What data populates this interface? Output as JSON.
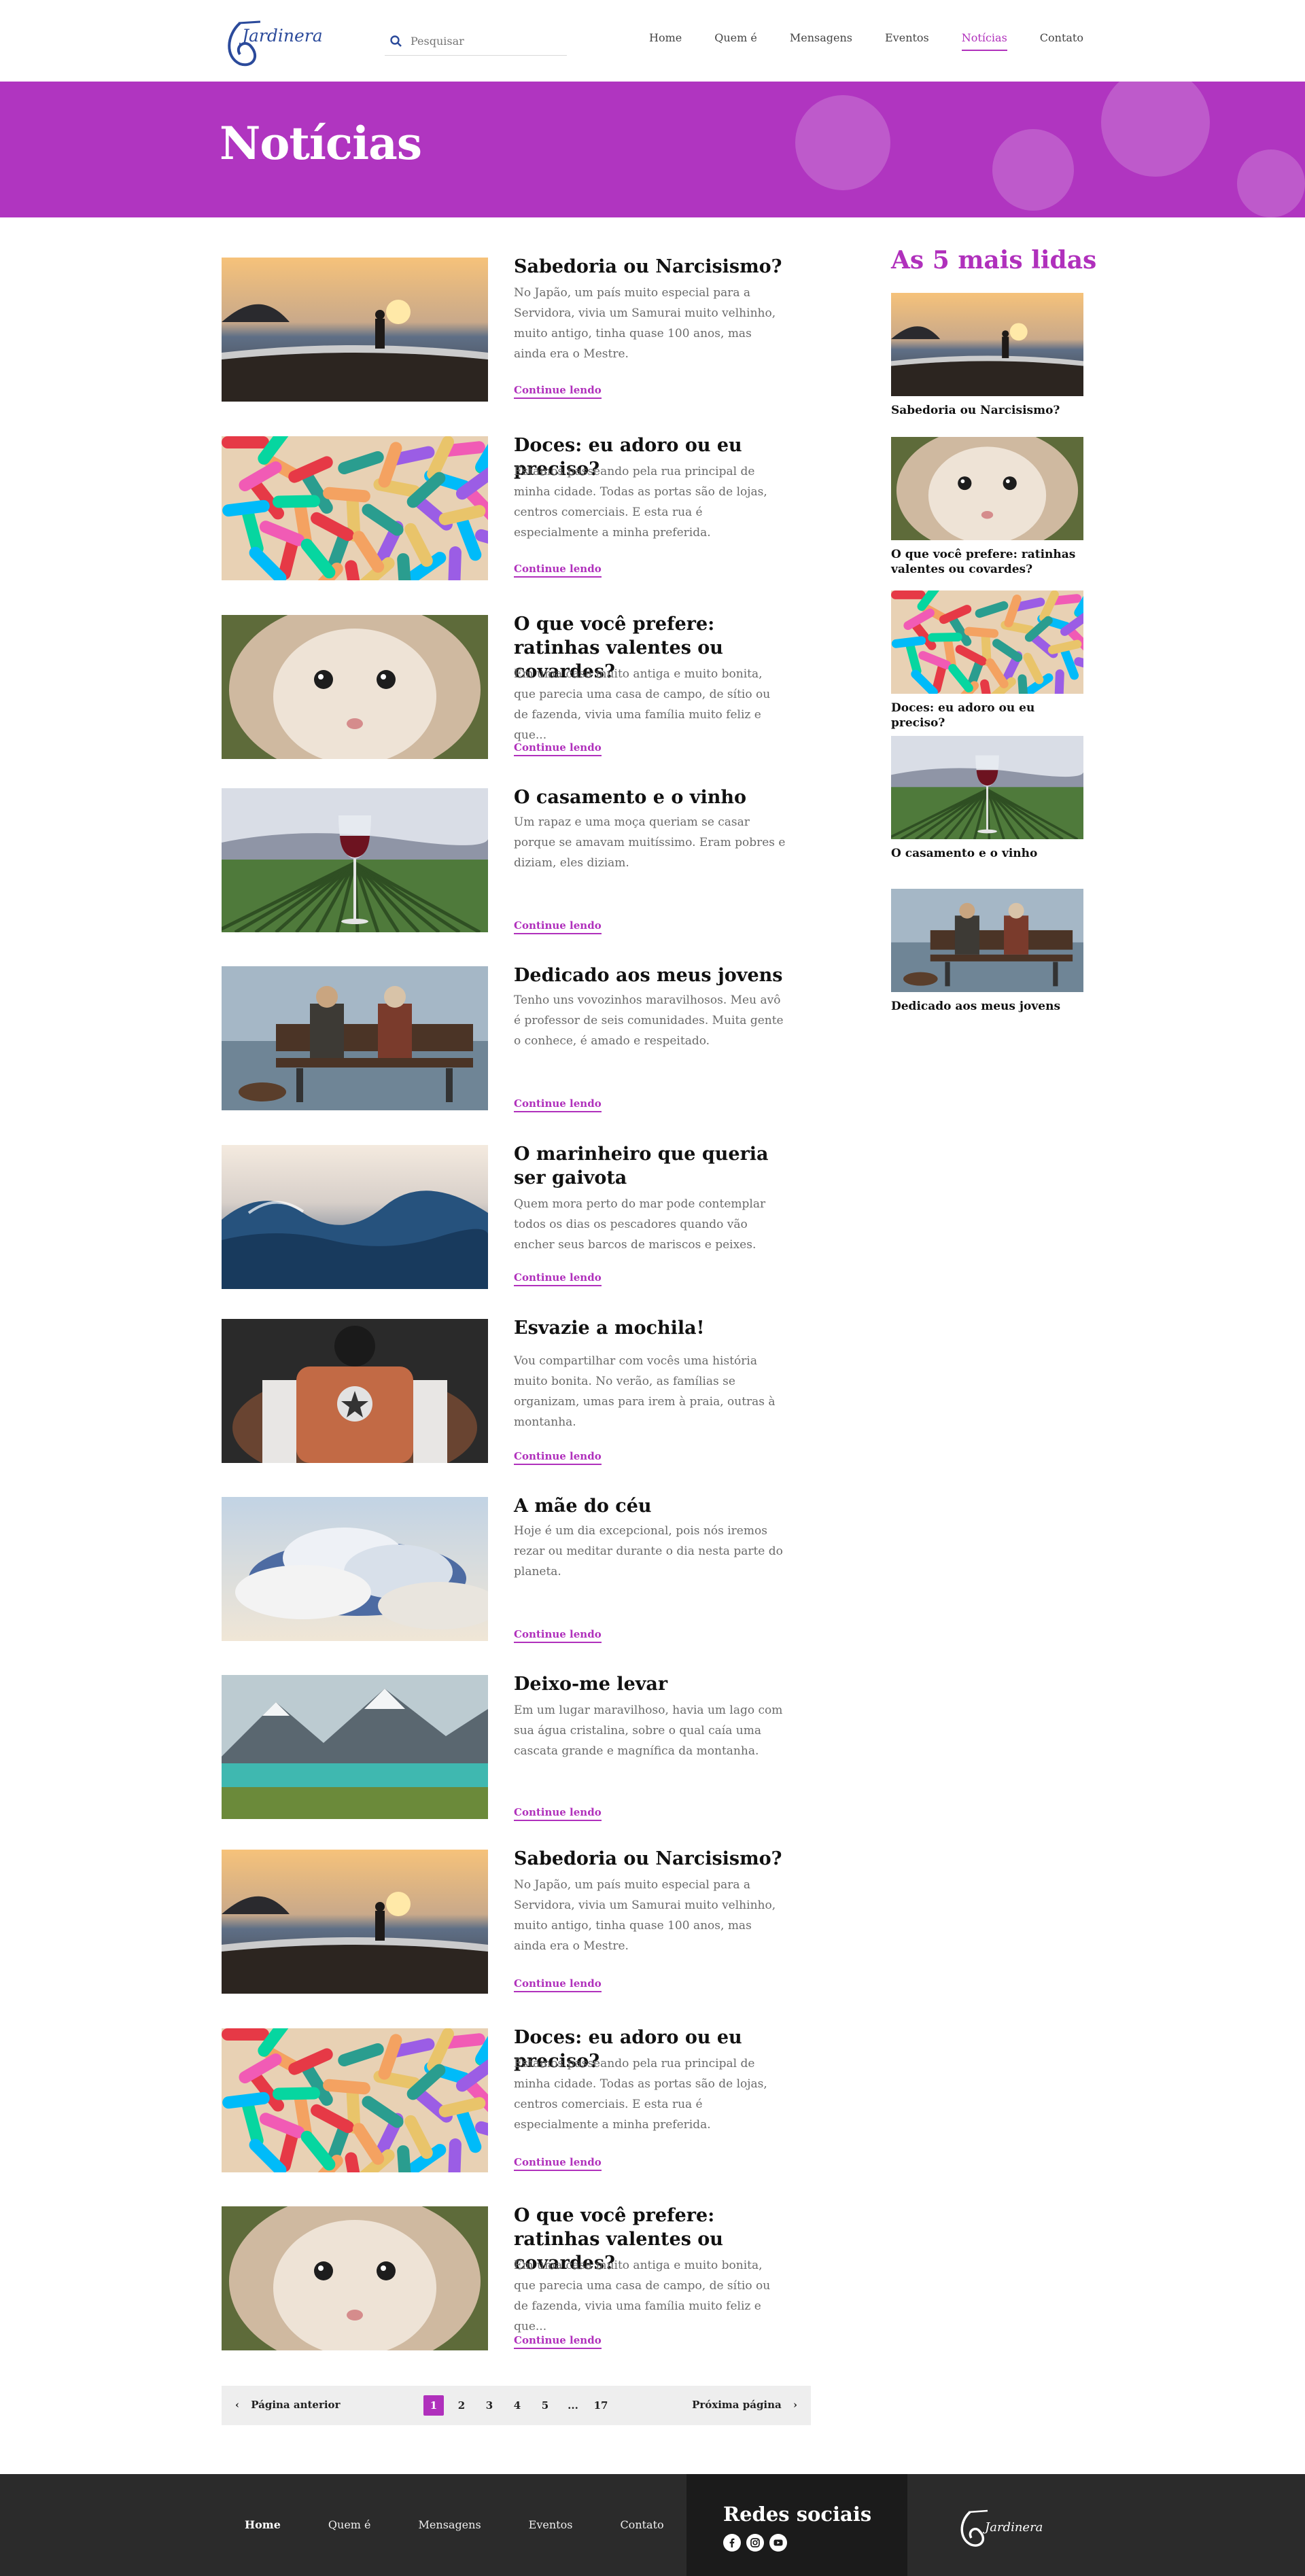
{
  "header": {
    "logo_text": "Jardinera",
    "search_placeholder": "Pesquisar",
    "nav": [
      "Home",
      "Quem é",
      "Mensagens",
      "Eventos",
      "Notícias",
      "Contato"
    ],
    "active_nav": "Notícias"
  },
  "hero": {
    "title": "Notícias"
  },
  "articles": [
    {
      "title": "Sabedoria ou Narcisismo?",
      "excerpt": "No Japão, um país muito especial para a Servidora, vivia um Samurai muito velhinho, muito antigo, tinha quase 100 anos, mas ainda era o Mestre.",
      "image": "beach-walker",
      "read_more": "Continue lendo"
    },
    {
      "title": "Doces: eu adoro ou eu preciso?",
      "excerpt": "Estamos passeando pela rua principal de minha cidade. Todas as portas são de lojas, centros comerciais. E esta rua é especialmente a minha preferida.",
      "image": "gummy-candies",
      "read_more": "Continue lendo"
    },
    {
      "title": "O que você prefere: ratinhas valentes ou covardes?",
      "excerpt": "Em uma casa muito antiga e muito bonita, que parecia uma casa de campo, de sítio ou de fazenda, vivia uma família muito feliz e que...",
      "image": "hamster",
      "read_more": "Continue lendo"
    },
    {
      "title": "O casamento e o vinho",
      "excerpt": "Um rapaz e uma moça queriam se casar porque se amavam muitíssimo. Eram pobres e diziam, eles diziam.",
      "image": "wine-vineyard",
      "read_more": "Continue lendo"
    },
    {
      "title": "Dedicado aos meus jovens",
      "excerpt": "Tenho uns vovozinhos maravilhosos. Meu avô é professor de seis comunidades. Muita gente o conhece, é amado e respeitado.",
      "image": "bench-couple",
      "read_more": "Continue lendo"
    },
    {
      "title": "O marinheiro que queria ser gaivota",
      "excerpt": "Quem mora perto do mar pode contemplar todos os dias os pescadores quando vão encher seus barcos de mariscos e peixes.",
      "image": "ocean-waves",
      "read_more": "Continue lendo"
    },
    {
      "title": "Esvazie a mochila!",
      "excerpt": "Vou compartilhar com vocês uma história muito bonita. No verão, as famílias se organizam, umas para irem à praia, outras à montanha.",
      "image": "backpack",
      "read_more": "Continue lendo"
    },
    {
      "title": "A mãe do céu",
      "excerpt": "Hoje é um dia excepcional, pois nós iremos rezar ou meditar durante o dia nesta parte do planeta.",
      "image": "clouds",
      "read_more": "Continue lendo"
    },
    {
      "title": "Deixo-me levar",
      "excerpt": "Em um lugar maravilhoso, havia um lago com sua água cristalina, sobre o qual caía uma cascata grande e magnífica da montanha.",
      "image": "mountain-lake",
      "read_more": "Continue lendo"
    },
    {
      "title": "Sabedoria ou Narcisismo?",
      "excerpt": "No Japão, um país muito especial para a Servidora, vivia um Samurai muito velhinho, muito antigo, tinha quase 100 anos, mas ainda era o Mestre.",
      "image": "beach-walker",
      "read_more": "Continue lendo"
    },
    {
      "title": "Doces: eu adoro ou eu preciso?",
      "excerpt": "Estamos passeando pela rua principal de minha cidade. Todas as portas são de lojas, centros comerciais. E esta rua é especialmente a minha preferida.",
      "image": "gummy-candies",
      "read_more": "Continue lendo"
    },
    {
      "title": "O que você prefere: ratinhas valentes ou covardes?",
      "excerpt": "Em uma casa muito antiga e muito bonita, que parecia uma casa de campo, de sítio ou de fazenda, vivia uma família muito feliz e que...",
      "image": "hamster",
      "read_more": "Continue lendo"
    }
  ],
  "sidebar": {
    "title": "As 5 mais lidas",
    "items": [
      {
        "label": "Sabedoria ou Narcisismo?",
        "image": "beach-walker"
      },
      {
        "label": "O que você prefere: ratinhas valentes ou covardes?",
        "image": "hamster"
      },
      {
        "label": "Doces: eu adoro ou eu preciso?",
        "image": "gummy-candies"
      },
      {
        "label": "O casamento e o vinho",
        "image": "wine-vineyard"
      },
      {
        "label": "Dedicado aos meus jovens",
        "image": "bench-couple"
      }
    ]
  },
  "pagination": {
    "prev": "Página anterior",
    "next": "Próxima página",
    "pages": [
      "1",
      "2",
      "3",
      "4",
      "5",
      "...",
      "17"
    ],
    "current": "1"
  },
  "footer": {
    "nav": [
      "Home",
      "Quem é",
      "Mensagens",
      "Eventos",
      "Contato"
    ],
    "social_title": "Redes sociais",
    "social_icons": [
      "facebook-icon",
      "instagram-icon",
      "youtube-icon"
    ],
    "logo_text": "Jardinera"
  },
  "colors": {
    "accent": "#b030bc",
    "hero": "#b035c0",
    "footer": "#2b2b2b",
    "footer_social": "#1b1b1b",
    "logo": "#2b4a9b"
  }
}
